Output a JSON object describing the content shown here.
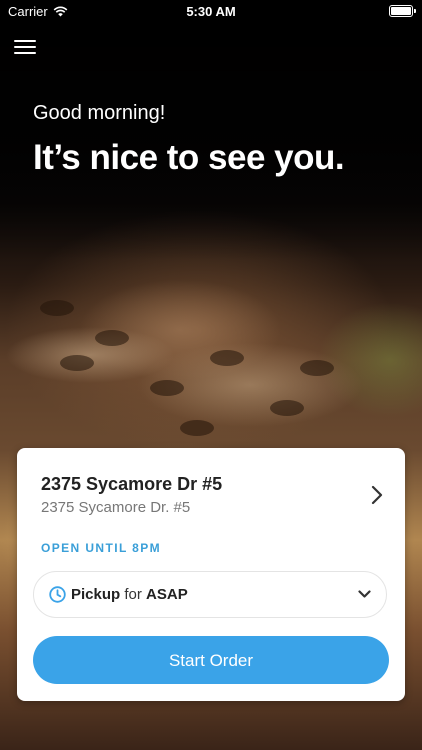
{
  "status_bar": {
    "carrier": "Carrier",
    "time": "5:30 AM",
    "icons": [
      "wifi-icon",
      "battery-icon"
    ]
  },
  "header": {
    "menu_icon": "menu-icon",
    "greeting": "Good morning!",
    "headline": "It’s nice to see you."
  },
  "location_card": {
    "location_name": "2375 Sycamore Dr #5",
    "address": "2375 Sycamore Dr. #5",
    "hours": "OPEN UNTIL 8PM",
    "order_mode": "Pickup",
    "for_label": "for",
    "time": "ASAP",
    "start_button": "Start Order"
  },
  "colors": {
    "accent": "#3aa3e8",
    "hours_text": "#3a9fd8"
  }
}
